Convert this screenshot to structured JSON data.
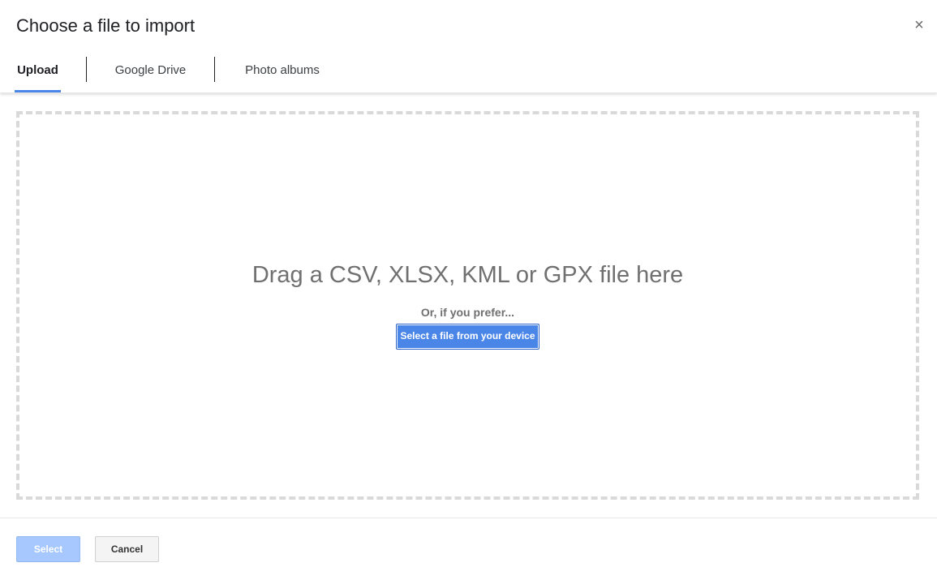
{
  "dialog": {
    "title": "Choose a file to import",
    "close_symbol": "×",
    "close_icon": "close-icon"
  },
  "tabs": [
    {
      "label": "Upload",
      "active": true
    },
    {
      "label": "Google Drive",
      "active": false
    },
    {
      "label": "Photo albums",
      "active": false
    }
  ],
  "dropzone": {
    "headline": "Drag a CSV, XLSX, KML or GPX file here",
    "sub": "Or, if you prefer...",
    "button_label": "Select a file from your device"
  },
  "footer": {
    "select_label": "Select",
    "cancel_label": "Cancel"
  },
  "colors": {
    "accent": "#4a86e8",
    "select_disabled": "#a6c8ff",
    "dashed_border": "#d9d9d9"
  }
}
